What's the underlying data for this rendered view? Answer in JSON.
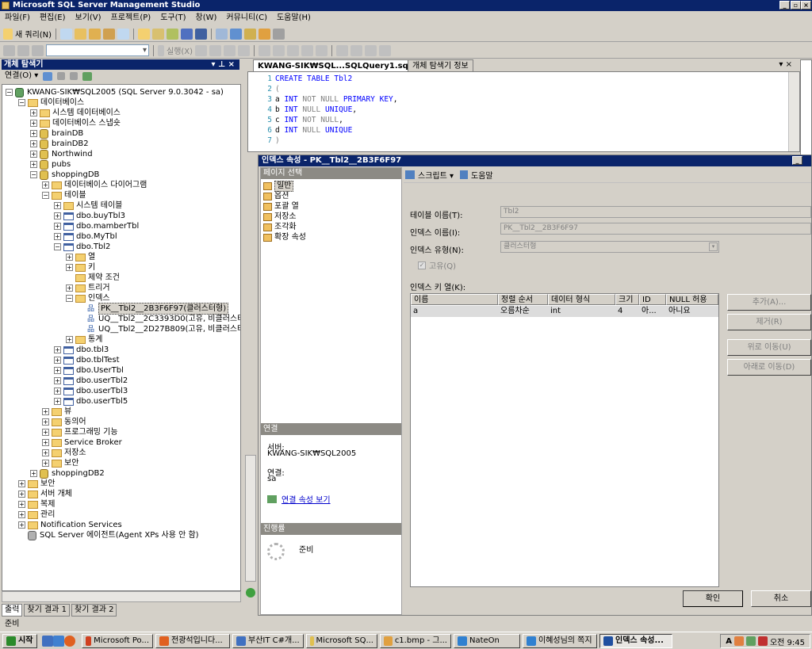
{
  "app": {
    "title": "Microsoft SQL Server Management Studio"
  },
  "menu": [
    "파일(F)",
    "편집(E)",
    "보기(V)",
    "프로젝트(P)",
    "도구(T)",
    "창(W)",
    "커뮤니티(C)",
    "도움말(H)"
  ],
  "toolbar": {
    "new_query": "새 쿼리(N)",
    "execute": "실행(X)"
  },
  "explorer": {
    "title": "개체 탐색기",
    "connect": "연결(O) ▾",
    "nodes": [
      "KWANG-SIK₩SQL2005 (SQL Server 9.0.3042 - sa)",
      "데이터베이스",
      "시스템 데이터베이스",
      "데이터베이스 스냅숏",
      "brainDB",
      "brainDB2",
      "Northwind",
      "pubs",
      "shoppingDB",
      "데이터베이스 다이어그램",
      "테이블",
      "시스템 테이블",
      "dbo.buyTbl3",
      "dbo.mamberTbl",
      "dbo.MyTbl",
      "dbo.Tbl2",
      "열",
      "키",
      "제약 조건",
      "트리거",
      "인덱스",
      "PK__Tbl2__2B3F6F97(클러스터형)",
      "UQ__Tbl2__2C3393D0(고유, 비클러스터형)",
      "UQ__Tbl2__2D27B809(고유, 비클러스터형)",
      "통계",
      "dbo.tbl3",
      "dbo.tblTest",
      "dbo.UserTbl",
      "dbo.userTbl2",
      "dbo.userTbl3",
      "dbo.userTbl5",
      "뷰",
      "동의어",
      "프로그래밍 기능",
      "Service Broker",
      "저장소",
      "보안",
      "shoppingDB2",
      "보안",
      "서버 개체",
      "복제",
      "관리",
      "Notification Services",
      "SQL Server 에이전트(Agent XPs 사용 안 함)"
    ]
  },
  "tabs": {
    "query": "KWANG-SIK₩SQL...SQLQuery1.sql*",
    "info": "개체 탐색기 정보"
  },
  "code": [
    {
      "n": "1",
      "t": "CREATE TABLE Tbl2"
    },
    {
      "n": "2",
      "t": "("
    },
    {
      "n": "3",
      "t": "a INT NOT NULL PRIMARY KEY,"
    },
    {
      "n": "4",
      "t": "b INT NULL UNIQUE,"
    },
    {
      "n": "5",
      "t": "c INT NOT NULL,"
    },
    {
      "n": "6",
      "t": "d INT NULL UNIQUE"
    },
    {
      "n": "7",
      "t": ")"
    }
  ],
  "dialog": {
    "title": "인덱스 속성 - PK__Tbl2__2B3F6F97",
    "page_select": "페이지 선택",
    "pages": [
      "일반",
      "옵션",
      "포괄 열",
      "저장소",
      "조각화",
      "확장 속성"
    ],
    "script": "스크립트 ▾",
    "help": "도움말",
    "table_name_label": "테이블 이름(T):",
    "table_name": "Tbl2",
    "index_name_label": "인덱스 이름(I):",
    "index_name": "PK__Tbl2__2B3F6F97",
    "index_type_label": "인덱스 유형(N):",
    "index_type": "클러스터형",
    "unique_label": "고유(Q)",
    "keycols_label": "인덱스 키 열(K):",
    "grid_headers": [
      "이름",
      "정렬 순서",
      "데이터 형식",
      "크기",
      "ID",
      "NULL 허용"
    ],
    "grid_row": [
      "a",
      "오름차순",
      "int",
      "4",
      "아...",
      "아니요"
    ],
    "buttons": {
      "add": "추가(A)...",
      "remove": "제거(R)",
      "up": "위로 이동(U)",
      "down": "아래로 이동(D)"
    },
    "connection_title": "연결",
    "server_label": "서버:",
    "server": "KWANG-SIK₩SQL2005",
    "conn_label": "연결:",
    "conn": "sa",
    "view_conn": "연결 속성 보기",
    "progress_title": "진행률",
    "progress_status": "준비",
    "ok": "확인",
    "cancel": "취소"
  },
  "output_tabs": [
    "출력",
    "찾기 결과 1",
    "찾기 결과 2"
  ],
  "status": "준비",
  "taskbar": {
    "start": "시작",
    "tasks": [
      "Microsoft Po...",
      "전광석입니다...",
      "부산IT C#개...",
      "Microsoft SQ...",
      "c1.bmp - 그...",
      "NateOn",
      "이혜성님의 쪽지",
      "인덱스 속성..."
    ],
    "clock": "오전 9:45"
  }
}
